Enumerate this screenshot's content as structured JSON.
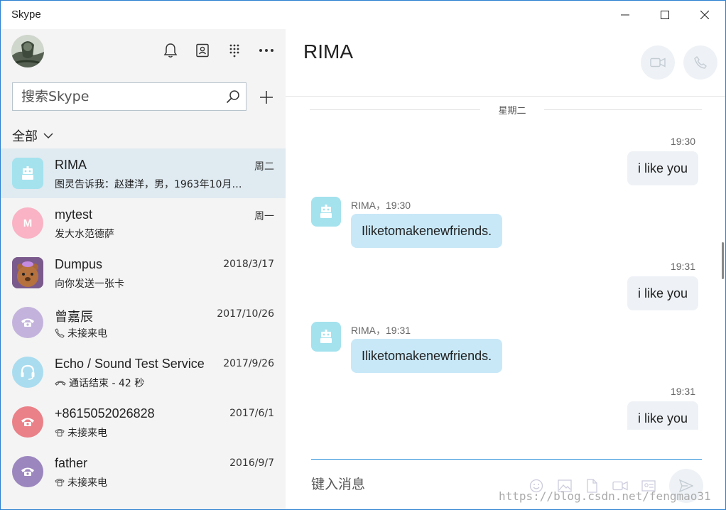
{
  "window": {
    "title": "Skype"
  },
  "sidebar": {
    "search_placeholder": "搜索Skype",
    "filter_label": "全部",
    "conversations": [
      {
        "name": "RIMA",
        "date": "周二",
        "preview": "图灵告诉我：赵建洋，男，1963年10月…",
        "avatar_icon": "bot-icon",
        "avatar_color": "#a4e2ee",
        "preview_icon": ""
      },
      {
        "name": "mytest",
        "date": "周一",
        "preview": "发大水范德萨",
        "avatar_letter": "M",
        "avatar_color": "#f9b3c4",
        "preview_icon": ""
      },
      {
        "name": "Dumpus",
        "date": "2018/3/17",
        "preview": "向你发送一张卡",
        "avatar_icon": "dumpus-bear-icon",
        "avatar_color": "#7a5a8c",
        "preview_icon": ""
      },
      {
        "name": "曾嘉辰",
        "date": "2017/10/26",
        "preview": "未接来电",
        "avatar_icon": "phone-icon",
        "avatar_color": "#c3b3dc",
        "preview_icon": "missed-call-icon"
      },
      {
        "name": "Echo / Sound Test Service",
        "date": "2017/9/26",
        "preview": "通话结束 - 42 秒",
        "avatar_icon": "headset-icon",
        "avatar_color": "#a9dcef",
        "preview_icon": "call-ended-icon"
      },
      {
        "name": "+8615052026828",
        "date": "2017/6/1",
        "preview": "未接来电",
        "avatar_icon": "phone-icon",
        "avatar_color": "#ea8088",
        "preview_icon": "missed-call-icon"
      },
      {
        "name": "father",
        "date": "2016/9/7",
        "preview": "未接来电",
        "avatar_icon": "phone-icon",
        "avatar_color": "#9b86be",
        "preview_icon": "missed-call-icon"
      }
    ]
  },
  "chat": {
    "title": "RIMA",
    "day_separator": "星期二",
    "messages": [
      {
        "direction": "out",
        "time": "19:30",
        "text": "i like you"
      },
      {
        "direction": "in",
        "meta": "RIMA，19:30",
        "text": "Iliketomakenewfriends."
      },
      {
        "direction": "out",
        "time": "19:31",
        "text": "i like you"
      },
      {
        "direction": "in",
        "meta": "RIMA，19:31",
        "text": "Iliketomakenewfriends."
      },
      {
        "direction": "out",
        "time": "19:31",
        "text": "i like you"
      }
    ],
    "compose_placeholder": "键入消息",
    "watermark": "https://blog.csdn.net/fengmao31"
  },
  "colors": {
    "accent": "#2b8fd9",
    "active_row": "#dfeaf1",
    "sidebar_bg": "#f4f4f4",
    "bubble_in": "#c8e8f7",
    "bubble_out": "#eef2f6"
  }
}
